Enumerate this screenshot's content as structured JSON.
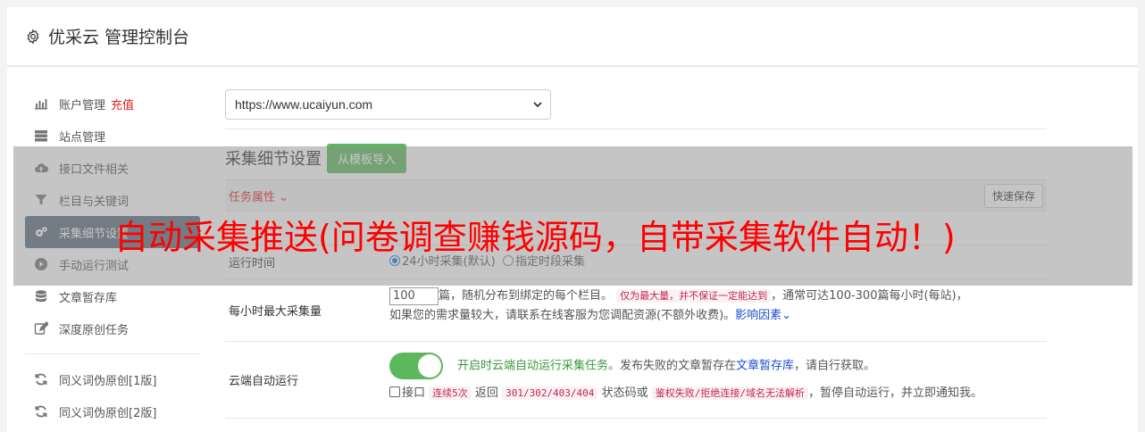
{
  "header": {
    "title": "优采云 管理控制台"
  },
  "sidebar": {
    "items": [
      {
        "label": "账户管理",
        "accent": "充值"
      },
      {
        "label": "站点管理"
      },
      {
        "label": "接口文件相关"
      },
      {
        "label": "栏目与关键词"
      },
      {
        "label": "采集细节设置"
      },
      {
        "label": "手动运行测试"
      },
      {
        "label": "文章暂存库"
      },
      {
        "label": "深度原创任务"
      },
      {
        "label": "同义词伪原创[1版]"
      },
      {
        "label": "同义词伪原创[2版]"
      }
    ]
  },
  "site_select": {
    "value": "https://www.ucaiyun.com"
  },
  "section": {
    "title": "采集细节设置",
    "import_button": "从模板导入"
  },
  "task_bar": {
    "label": "任务属性",
    "save_button": "快速保存"
  },
  "run_time": {
    "label": "运行时间",
    "option1": "24小时采集(默认)",
    "option2": "指定时段采集"
  },
  "max_per_hour": {
    "label": "每小时最大采集量",
    "value": "100",
    "text1": "篇，随机分布到绑定的每个栏目。",
    "code1": "仅为最大量，并不保证一定能达到",
    "text2": "，通常可达100-300篇每小时(每站)，",
    "text3": "如果您的需求量较大，请联系在线客服为您调配资源(不额外收费)。",
    "link": "影响因素"
  },
  "cloud_run": {
    "label": "云端自动运行",
    "green_text": "开启时云端自动运行采集任务。",
    "text1": "发布失败的文章暂存在",
    "link": "文章暂存库",
    "text2": "，请自行获取。",
    "check_label": "接口",
    "code1": "连续5次",
    "text3": "返回",
    "code2": "301/302/403/404",
    "text4": "状态码或",
    "code3": "鉴权失败/拒绝连接/域名无法解析",
    "text5": "，暂停自动运行，并立即通知我。"
  },
  "overlay": {
    "text": "自动采集推送(问卷调查赚钱源码，自带采集软件自动！)"
  }
}
